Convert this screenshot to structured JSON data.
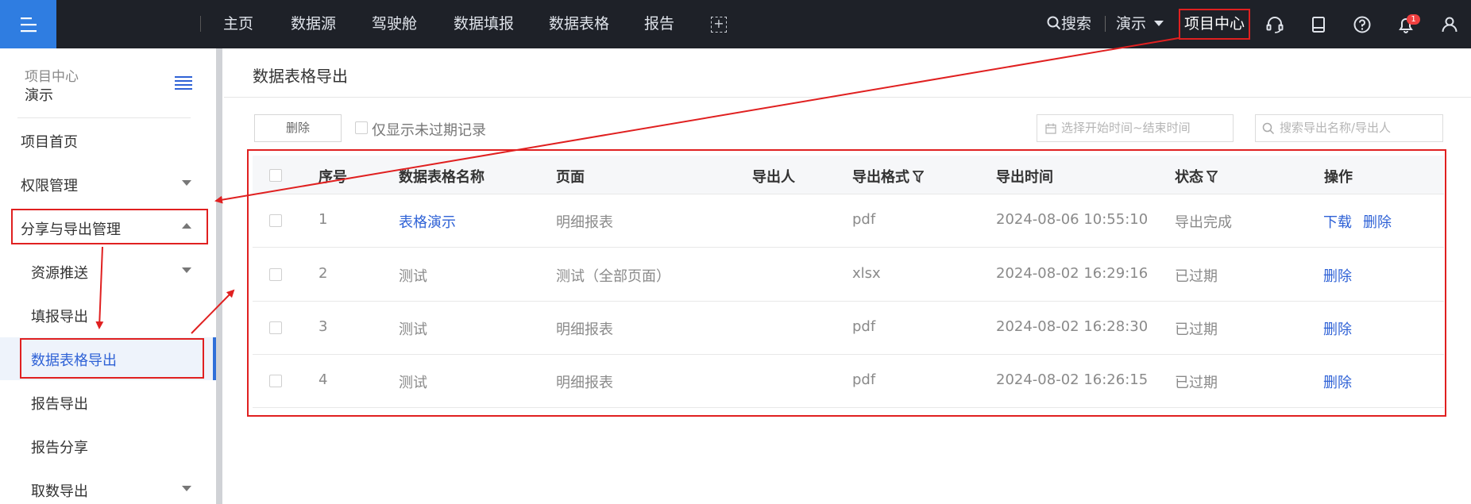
{
  "topnav": {
    "items": [
      "主页",
      "数据源",
      "驾驶舱",
      "数据填报",
      "数据表格",
      "报告"
    ],
    "search_label": "搜索",
    "user_label": "演示",
    "project_center": "项目中心",
    "notification_count": "1"
  },
  "sidebar": {
    "project_label": "项目中心",
    "project_name": "演示",
    "items": {
      "home": "项目首页",
      "permission": "权限管理",
      "share_export": "分享与导出管理",
      "resource_push": "资源推送",
      "fill_export": "填报导出",
      "table_export": "数据表格导出",
      "report_export": "报告导出",
      "report_share": "报告分享",
      "fetch_export": "取数导出"
    }
  },
  "main": {
    "title": "数据表格导出",
    "delete_button": "删除",
    "filter_unexpired": "仅显示未过期记录",
    "date_placeholder": "选择开始时间~结束时间",
    "search_placeholder": "搜索导出名称/导出人",
    "columns": [
      "序号",
      "数据表格名称",
      "页面",
      "导出人",
      "导出格式",
      "导出时间",
      "状态",
      "操作"
    ],
    "rows": [
      {
        "index": "1",
        "name": "表格演示",
        "page": "明细报表",
        "exporter": "",
        "format": "pdf",
        "time": "2024-08-06 10:55:10",
        "status": "导出完成",
        "actions": [
          "下载",
          "删除"
        ]
      },
      {
        "index": "2",
        "name": "测试",
        "page": "测试（全部页面）",
        "exporter": "",
        "format": "xlsx",
        "time": "2024-08-02 16:29:16",
        "status": "已过期",
        "actions": [
          "删除"
        ]
      },
      {
        "index": "3",
        "name": "测试",
        "page": "明细报表",
        "exporter": "",
        "format": "pdf",
        "time": "2024-08-02 16:28:30",
        "status": "已过期",
        "actions": [
          "删除"
        ]
      },
      {
        "index": "4",
        "name": "测试",
        "page": "明细报表",
        "exporter": "",
        "format": "pdf",
        "time": "2024-08-02 16:26:15",
        "status": "已过期",
        "actions": [
          "删除"
        ]
      }
    ]
  },
  "colors": {
    "topbar": "#1e2128",
    "accent": "#2f7de1",
    "link": "#2f62d6",
    "annotation": "#e02020"
  }
}
